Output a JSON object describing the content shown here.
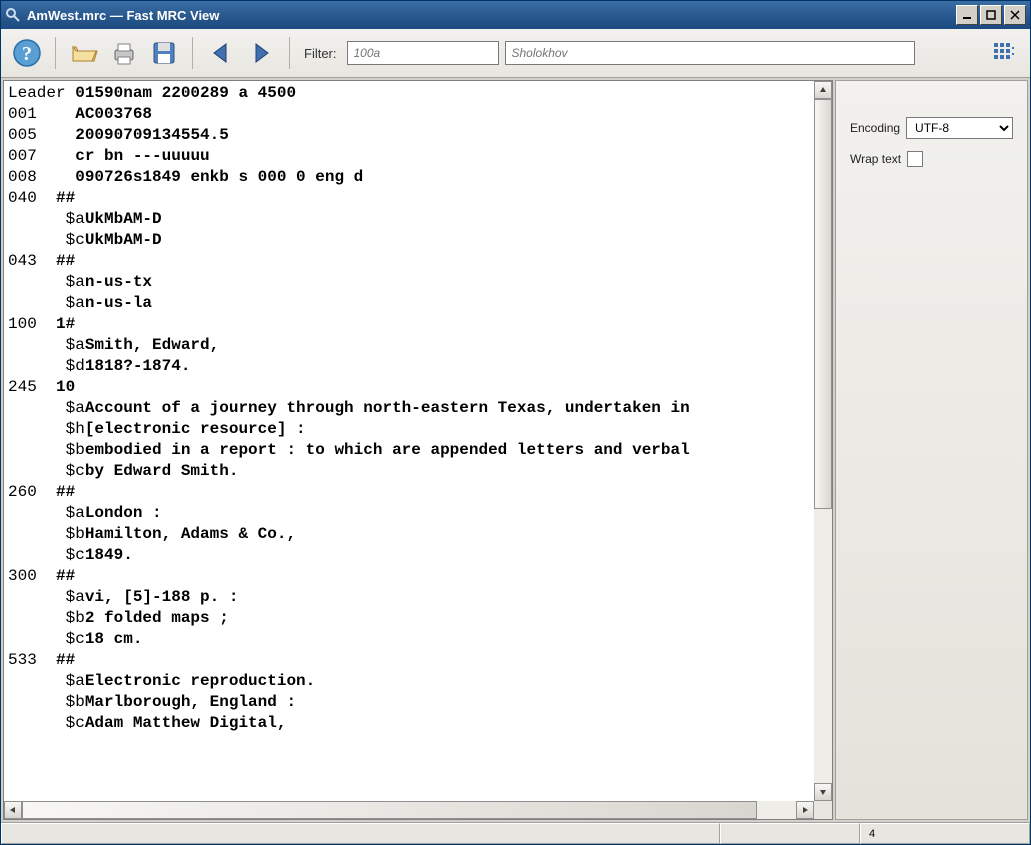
{
  "window": {
    "title": "AmWest.mrc — Fast MRC View"
  },
  "toolbar": {
    "filter_label": "Filter:",
    "filter_placeholder": "100a",
    "search_placeholder": "Sholokhov"
  },
  "side": {
    "encoding_label": "Encoding",
    "encoding_value": "UTF-8",
    "wrap_label": "Wrap text",
    "wrap_checked": false
  },
  "status": {
    "cell1": "",
    "cell2": "",
    "cell3": "4"
  },
  "record": {
    "fields": [
      {
        "tag": "Leader",
        "ind": "",
        "subs": [],
        "value": "01590nam 2200289 a 4500"
      },
      {
        "tag": "001",
        "ind": "",
        "subs": [],
        "value": "AC003768"
      },
      {
        "tag": "005",
        "ind": "",
        "subs": [],
        "value": "20090709134554.5"
      },
      {
        "tag": "007",
        "ind": "",
        "subs": [],
        "value": "cr bn ---uuuuu"
      },
      {
        "tag": "008",
        "ind": "",
        "subs": [],
        "value": "090726s1849 enkb s 000 0 eng d"
      },
      {
        "tag": "040",
        "ind": "##",
        "subs": [
          {
            "code": "$a",
            "val": "UkMbAM-D"
          },
          {
            "code": "$c",
            "val": "UkMbAM-D"
          }
        ]
      },
      {
        "tag": "043",
        "ind": "##",
        "subs": [
          {
            "code": "$a",
            "val": "n-us-tx"
          },
          {
            "code": "$a",
            "val": "n-us-la"
          }
        ]
      },
      {
        "tag": "100",
        "ind": "1#",
        "subs": [
          {
            "code": "$a",
            "val": "Smith, Edward,"
          },
          {
            "code": "$d",
            "val": "1818?-1874."
          }
        ]
      },
      {
        "tag": "245",
        "ind": "10",
        "subs": [
          {
            "code": "$a",
            "val": "Account of a journey through north-eastern Texas, undertaken in"
          },
          {
            "code": "$h",
            "val": "[electronic resource] :"
          },
          {
            "code": "$b",
            "val": "embodied in a report : to which are appended letters and verbal"
          },
          {
            "code": "$c",
            "val": "by Edward Smith."
          }
        ]
      },
      {
        "tag": "260",
        "ind": "##",
        "subs": [
          {
            "code": "$a",
            "val": "London :"
          },
          {
            "code": "$b",
            "val": "Hamilton, Adams & Co.,"
          },
          {
            "code": "$c",
            "val": "1849."
          }
        ]
      },
      {
        "tag": "300",
        "ind": "##",
        "subs": [
          {
            "code": "$a",
            "val": "vi, [5]-188 p. :"
          },
          {
            "code": "$b",
            "val": "2 folded maps ;"
          },
          {
            "code": "$c",
            "val": "18 cm."
          }
        ]
      },
      {
        "tag": "533",
        "ind": "##",
        "subs": [
          {
            "code": "$a",
            "val": "Electronic reproduction."
          },
          {
            "code": "$b",
            "val": "Marlborough, England :"
          },
          {
            "code": "$c",
            "val": "Adam Matthew Digital,"
          }
        ]
      }
    ]
  }
}
